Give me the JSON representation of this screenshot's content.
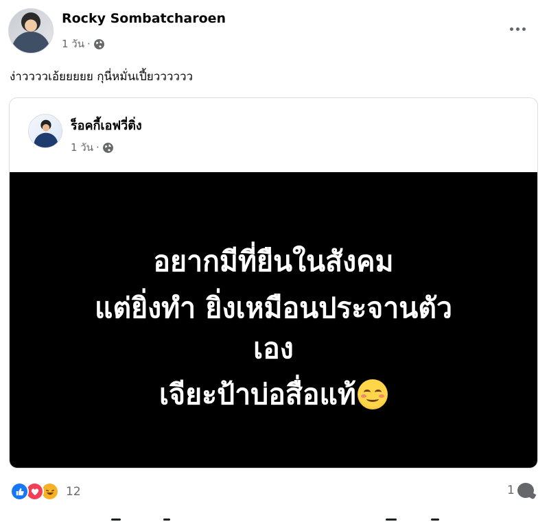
{
  "post": {
    "author": "Rocky Sombatcharoen",
    "time": "1 วัน",
    "separator": "·",
    "text": "ง่าววววเอ้ยยยยย กุนี่หมั่นเปี้ยวววววว"
  },
  "shared": {
    "author": "ร็อคกี้เอฟวี่ติ่ง",
    "time": "1 วัน",
    "separator": "·",
    "quote_lines": [
      "อยากมีที่ยืนในสังคม",
      "แต่ยิ่งทำ ยิ่งเหมือนประจานตัว",
      "เอง",
      "เจียะป้าบ่อสื่อแท้"
    ],
    "quote_emoji": "smiling-blush-emoji"
  },
  "footer": {
    "reaction_count": "12",
    "comment_count": "1",
    "reactions": [
      "like-icon",
      "love-icon",
      "haha-icon"
    ]
  },
  "colors": {
    "like": "#1877f2",
    "love": "#f33e58",
    "haha": "#f7b125",
    "meta_gray": "#65676b",
    "image_bg": "#000000"
  }
}
